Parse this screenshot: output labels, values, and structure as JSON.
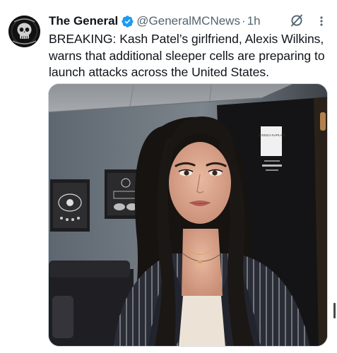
{
  "tweet": {
    "author_name": "The General",
    "handle": "@GeneralMCNews",
    "separator": "·",
    "time": "1h",
    "text": "BREAKING: Kash Patel’s girlfriend, Alexis Wilkins, warns that additional sleeper cells are preparing to launch attacks across the United States."
  },
  "media": {
    "door_sign_text": "JESSICA KAPLAN"
  },
  "icons": {
    "verified": "verified-badge-icon",
    "grok": "grok-icon",
    "more": "more-options-icon",
    "avatar": "skull-avatar"
  },
  "colors": {
    "verified_blue": "#1d9bf0",
    "text_primary": "#0f1419",
    "text_secondary": "#536471"
  }
}
